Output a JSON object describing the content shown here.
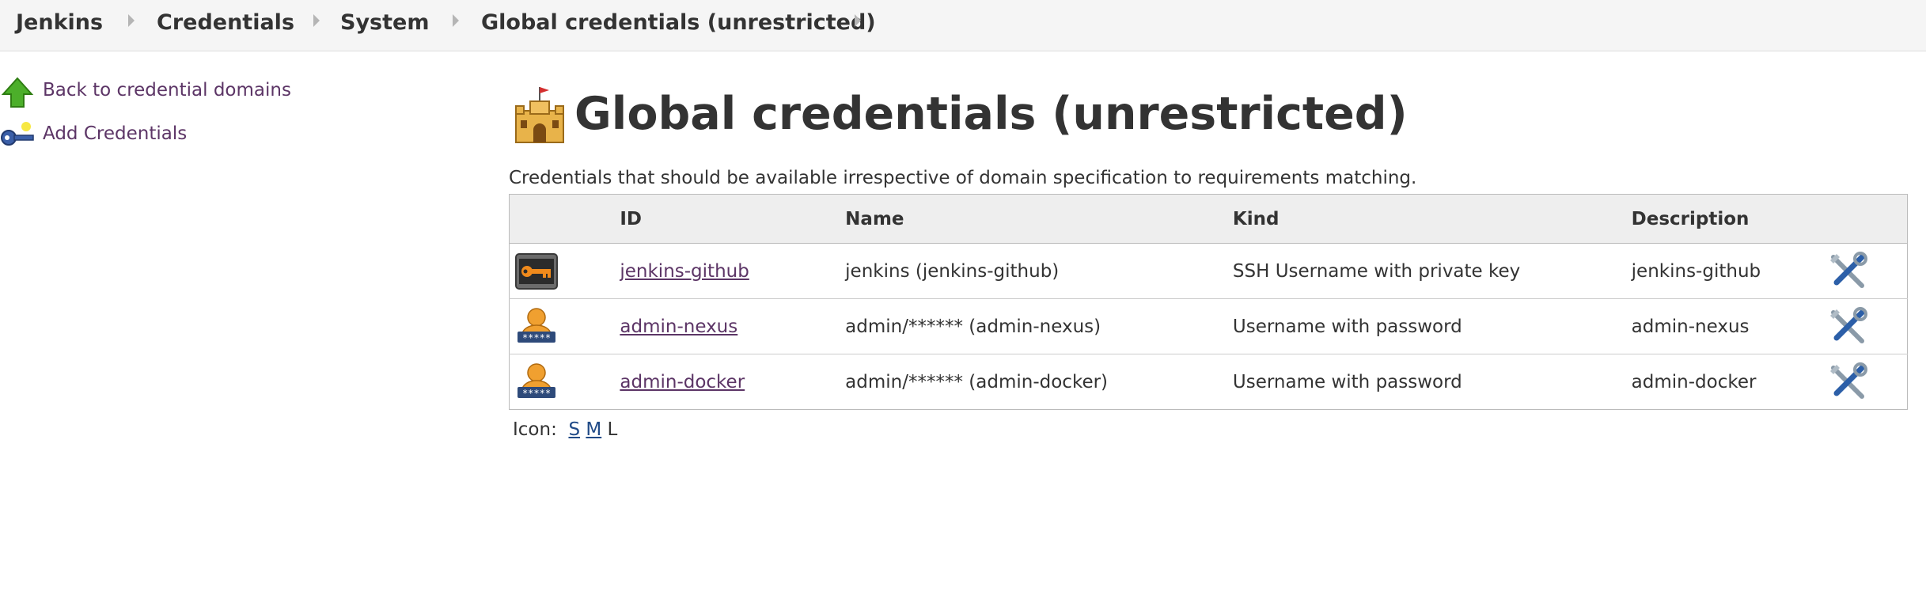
{
  "breadcrumb": {
    "items": [
      "Jenkins",
      "Credentials",
      "System",
      "Global credentials (unrestricted)"
    ]
  },
  "sidebar": {
    "items": [
      {
        "label": "Back to credential domains",
        "icon": "up-arrow-icon"
      },
      {
        "label": "Add Credentials",
        "icon": "key-icon"
      }
    ]
  },
  "main": {
    "title": "Global credentials (unrestricted)",
    "title_icon": "castle-icon",
    "description": "Credentials that should be available irrespective of domain specification to requirements matching.",
    "table": {
      "headers": [
        "ID",
        "Name",
        "Kind",
        "Description"
      ],
      "rows": [
        {
          "icon": "ssh-key-icon",
          "id": "jenkins-github",
          "name": "jenkins (jenkins-github)",
          "kind": "SSH Username with private key",
          "description": "jenkins-github"
        },
        {
          "icon": "user-password-icon",
          "id": "admin-nexus",
          "name": "admin/****** (admin-nexus)",
          "kind": "Username with password",
          "description": "admin-nexus"
        },
        {
          "icon": "user-password-icon",
          "id": "admin-docker",
          "name": "admin/****** (admin-docker)",
          "kind": "Username with password",
          "description": "admin-docker"
        }
      ],
      "action_icon": "configure-tools-icon"
    },
    "icon_size": {
      "label": "Icon:",
      "options": [
        "S",
        "M",
        "L"
      ],
      "selected": "L"
    }
  },
  "colors": {
    "link": "#5c3566",
    "header_bg": "#eeeeee",
    "breadcrumb_bg": "#f5f5f5"
  }
}
